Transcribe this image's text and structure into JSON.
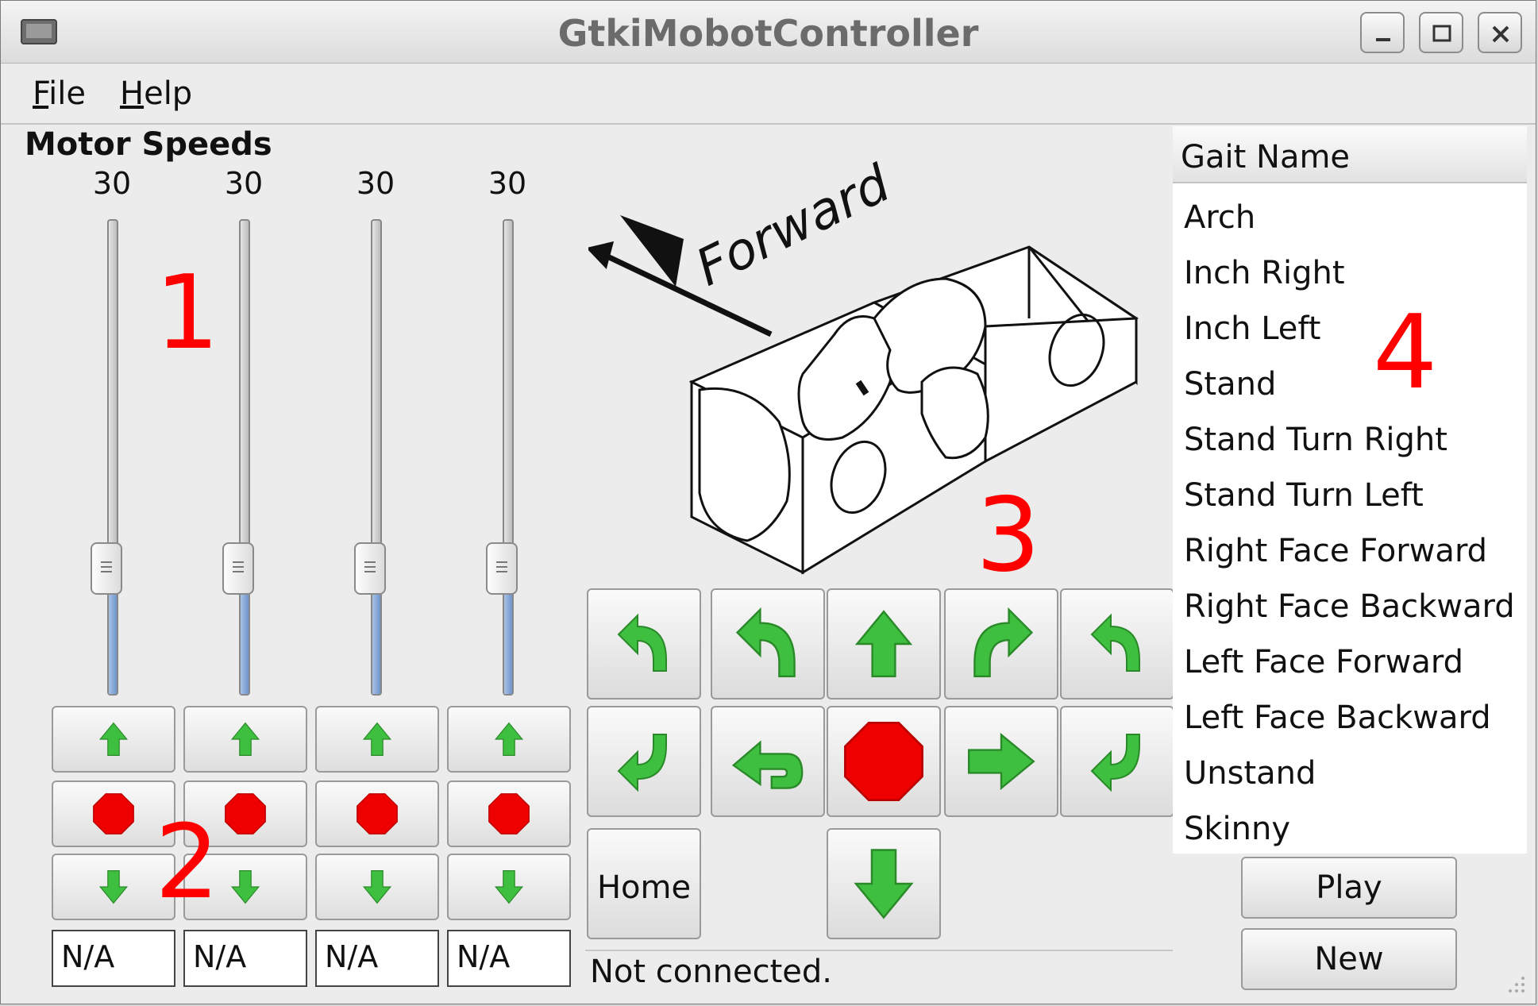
{
  "window": {
    "title": "GtkiMobotController",
    "menu": [
      {
        "label": "File",
        "mnemonic": "F",
        "rest": "ile"
      },
      {
        "label": "Help",
        "mnemonic": "H",
        "rest": "elp"
      }
    ]
  },
  "motors": {
    "section_title": "Motor Speeds",
    "speeds": [
      "30",
      "30",
      "30",
      "30"
    ],
    "slider_level_fraction": [
      0.27,
      0.27,
      0.27,
      0.27
    ],
    "positions": [
      "N/A",
      "N/A",
      "N/A",
      "N/A"
    ]
  },
  "robot_image": {
    "direction_label": "Forward"
  },
  "navigation": {
    "home_label": "Home",
    "status": "Not connected."
  },
  "gaits": {
    "header": "Gait Name",
    "items": [
      "Arch",
      "Inch Right",
      "Inch Left",
      "Stand",
      "Stand Turn Right",
      "Stand Turn Left",
      "Right Face Forward",
      "Right Face Backward",
      "Left Face Forward",
      "Left Face Backward",
      "Unstand",
      "Skinny"
    ],
    "play_label": "Play",
    "new_label": "New"
  },
  "annotations": [
    "1",
    "2",
    "3",
    "4"
  ],
  "colors": {
    "arrow_green": "#3fbf3f",
    "stop_red": "#ee0000",
    "annotation_red": "#ff0000",
    "slider_fill": "#7f9fd3"
  }
}
